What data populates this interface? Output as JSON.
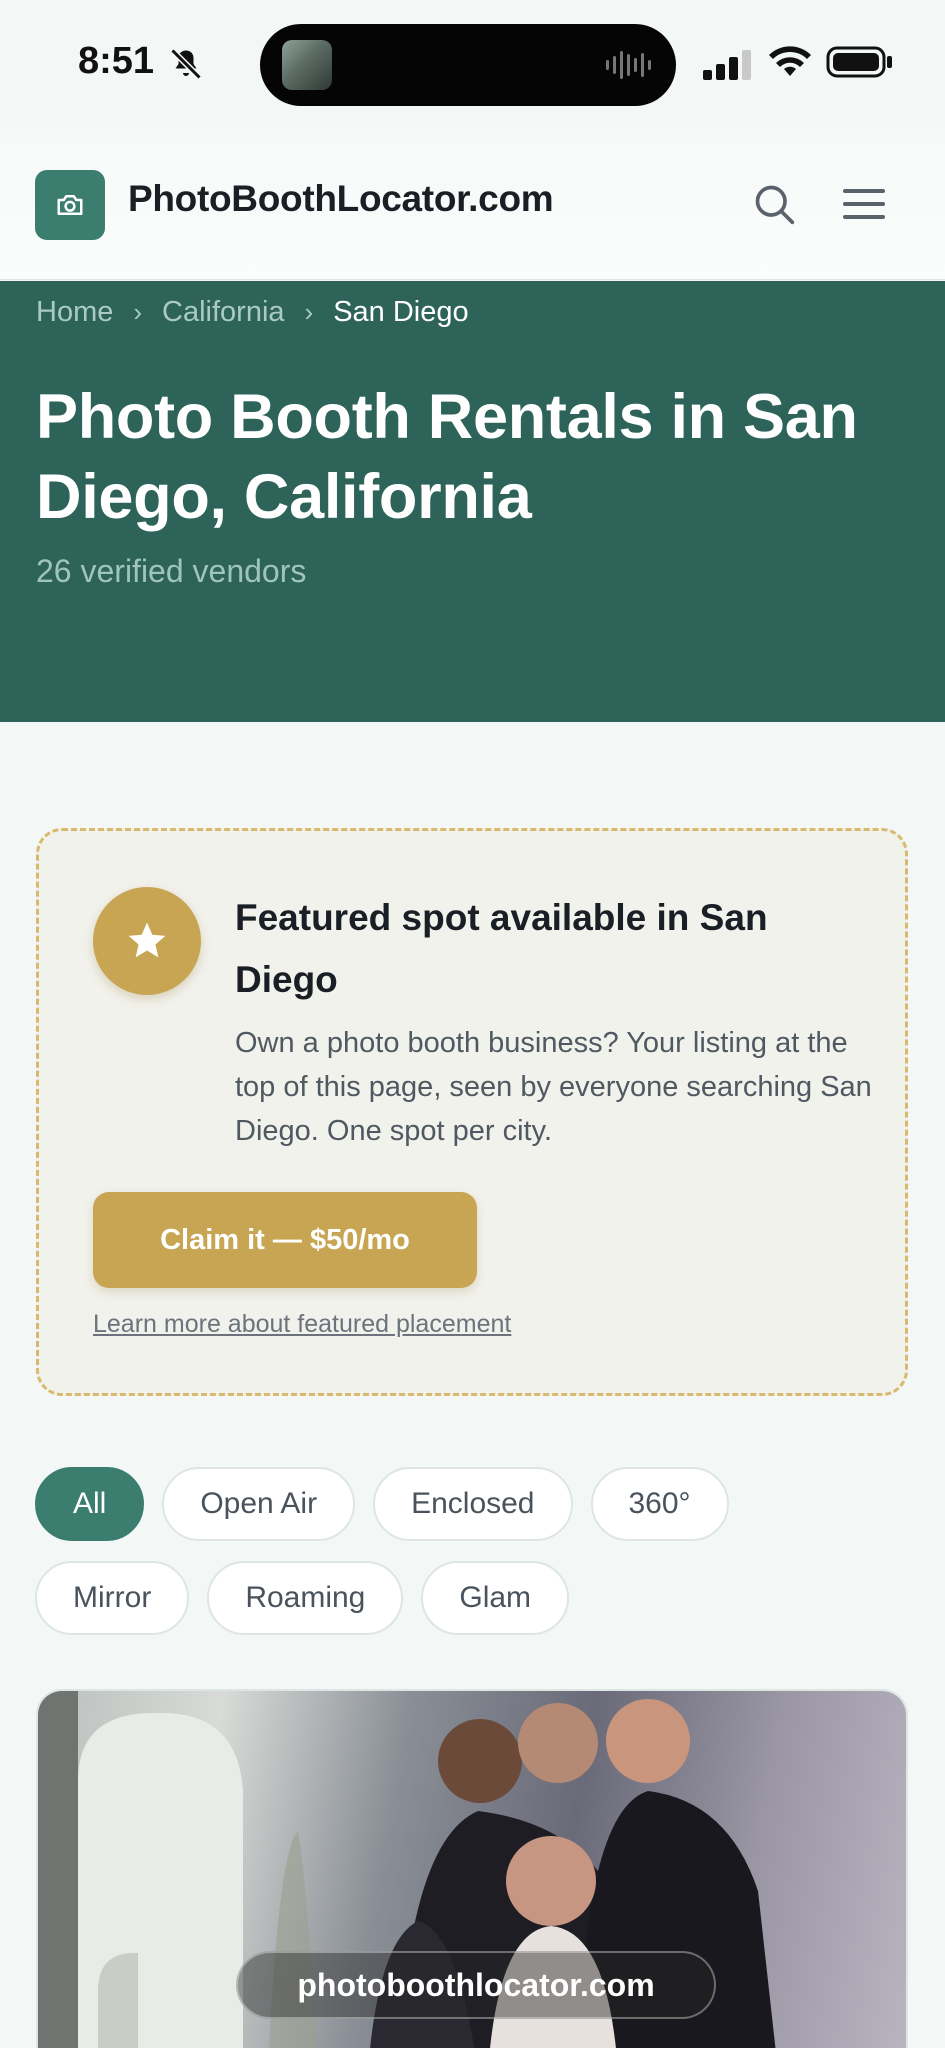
{
  "status_bar": {
    "time": "8:51",
    "icons": [
      "bell-slash-icon",
      "signal-icon",
      "wifi-icon",
      "battery-icon"
    ]
  },
  "header": {
    "site_name": "PhotoBoothLocator.com",
    "logo_icon": "camera-icon",
    "actions": [
      "search-icon",
      "menu-icon"
    ]
  },
  "breadcrumb": {
    "items": [
      "Home",
      "California",
      "San Diego"
    ]
  },
  "hero": {
    "title": "Photo Booth Rentals in San Diego, California",
    "subtitle": "26 verified vendors"
  },
  "featured": {
    "icon": "star-icon",
    "title": "Featured spot available in San Diego",
    "description": "Own a photo booth business? Your listing at the top of this page, seen by everyone searching San Diego. One spot per city.",
    "cta_label": "Claim it — $50/mo",
    "link_text": "Learn more about featured placement"
  },
  "filters": {
    "row1": [
      "All",
      "Open Air",
      "Enclosed",
      "360°"
    ],
    "row2": [
      "Mirror",
      "Roaming",
      "Glam"
    ],
    "active": "All"
  },
  "listing": {
    "watermark": "photoboothlocator.com"
  },
  "colors": {
    "brand": "#3b7d6f",
    "hero_bg": "#2e6359",
    "gold": "#c8a553"
  }
}
